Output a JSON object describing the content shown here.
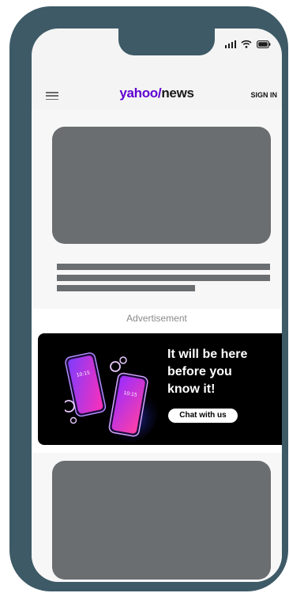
{
  "header": {
    "brand_yahoo": "yahoo/",
    "brand_news": "news",
    "sign_in_label": "SIGN IN"
  },
  "status_bar": {
    "icons": [
      "signal-icon",
      "wifi-icon",
      "battery-icon"
    ]
  },
  "ad": {
    "label": "Advertisement",
    "headline_line1": "It will be here",
    "headline_line2": "before you",
    "headline_line3": "know it!",
    "cta_label": "Chat with us",
    "phone_time_1": "10:15",
    "phone_time_2": "10:15"
  },
  "colors": {
    "frame": "#3d5a66",
    "placeholder": "#6b6e70",
    "brand_purple": "#6001d2",
    "ad_background": "#000000"
  }
}
